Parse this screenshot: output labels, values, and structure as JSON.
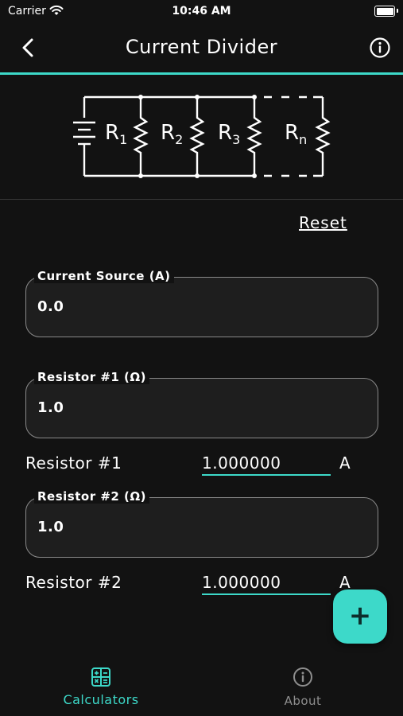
{
  "status_bar": {
    "carrier": "Carrier",
    "time": "10:46 AM"
  },
  "nav": {
    "title": "Current Divider"
  },
  "diagram": {
    "labels": [
      "R1",
      "R2",
      "R3",
      "Rn"
    ]
  },
  "reset_label": "Reset",
  "fields": [
    {
      "label": "Current Source (A)",
      "value": "0.0"
    },
    {
      "label": "Resistor #1 (Ω)",
      "value": "1.0"
    },
    {
      "label": "Resistor #2 (Ω)",
      "value": "1.0"
    }
  ],
  "results": [
    {
      "label": "Resistor #1",
      "value": "1.000000",
      "unit": "A"
    },
    {
      "label": "Resistor #2",
      "value": "1.000000",
      "unit": "A"
    }
  ],
  "fab": {
    "icon": "plus-icon"
  },
  "tabs": [
    {
      "label": "Calculators",
      "icon": "calculator-icon",
      "active": true
    },
    {
      "label": "About",
      "icon": "info-icon",
      "active": false
    }
  ],
  "colors": {
    "accent": "#3dd9c9",
    "background": "#121212",
    "inactive": "#8e8e8e"
  }
}
